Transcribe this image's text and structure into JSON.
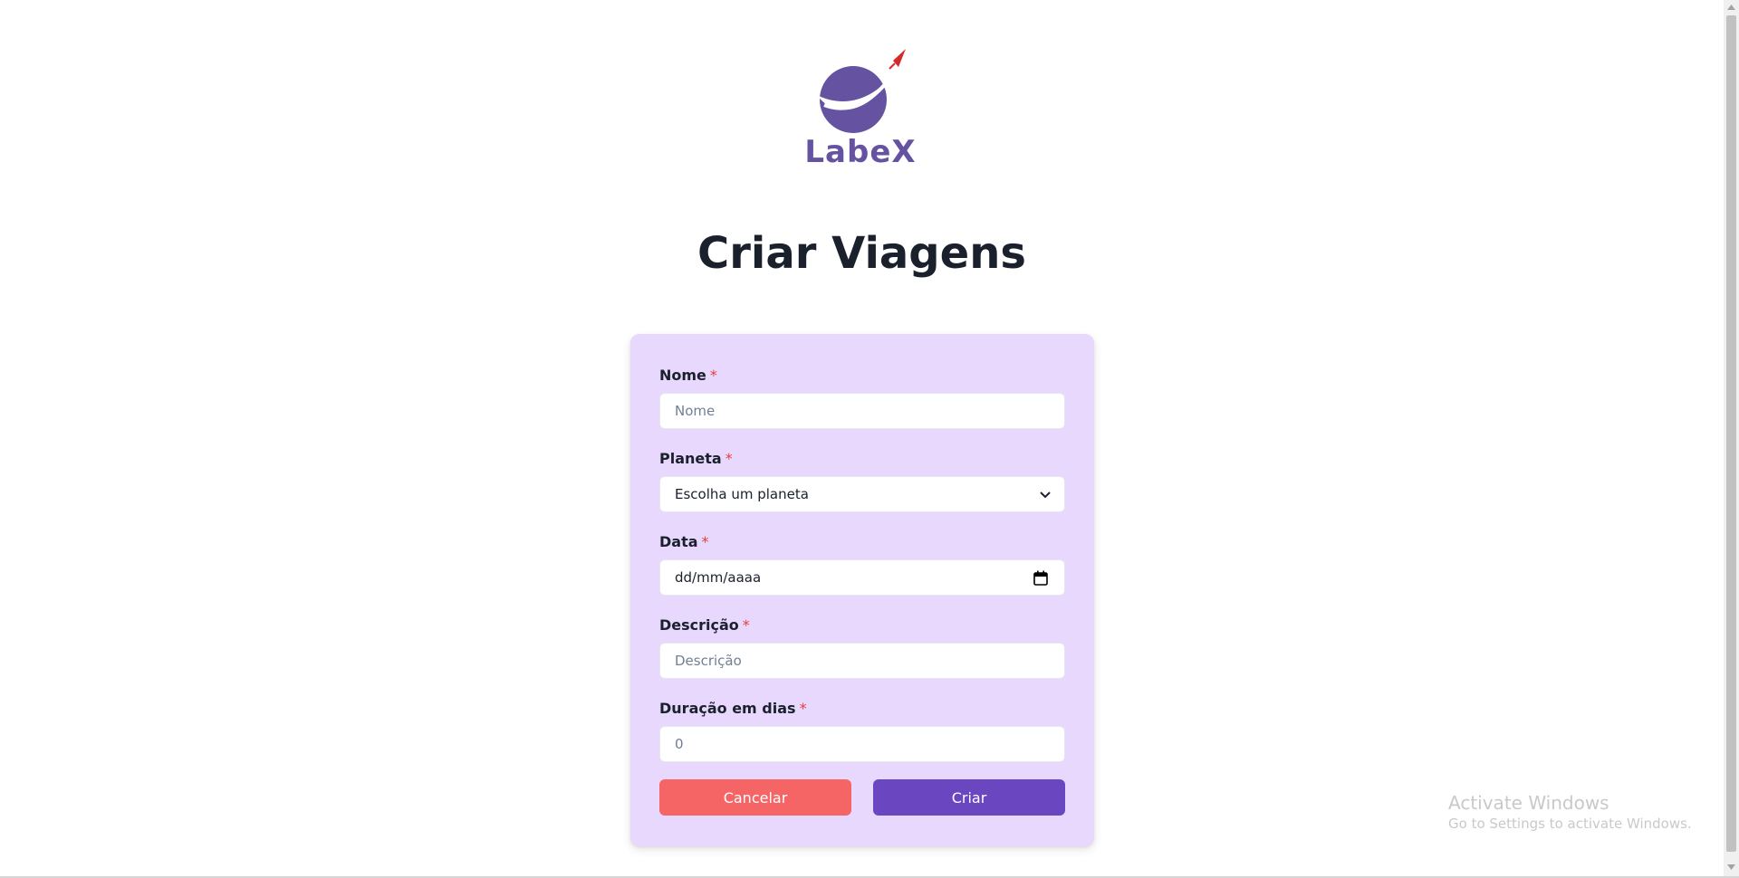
{
  "logo": {
    "text": "LabeX",
    "colors": {
      "planet": "#6553a2",
      "rocket": "#d42a2a"
    }
  },
  "page_title": "Criar Viagens",
  "form": {
    "fields": [
      {
        "label": "Nome",
        "required_mark": "*",
        "placeholder": "Nome"
      },
      {
        "label": "Planeta",
        "required_mark": "*",
        "selected": "Escolha um planeta"
      },
      {
        "label": "Data",
        "required_mark": "*",
        "value": "dd/mm/aaaa"
      },
      {
        "label": "Descrição",
        "required_mark": "*",
        "placeholder": "Descrição"
      },
      {
        "label": "Duração em dias",
        "required_mark": "*",
        "placeholder": "0"
      }
    ],
    "buttons": {
      "cancel": "Cancelar",
      "create": "Criar"
    }
  },
  "colors": {
    "card_bg": "#e9d8fd",
    "cancel_button": "#f56565",
    "create_button": "#6b46c1",
    "required_mark": "#e53e3e"
  },
  "watermark": {
    "title": "Activate Windows",
    "subtitle": "Go to Settings to activate Windows."
  }
}
